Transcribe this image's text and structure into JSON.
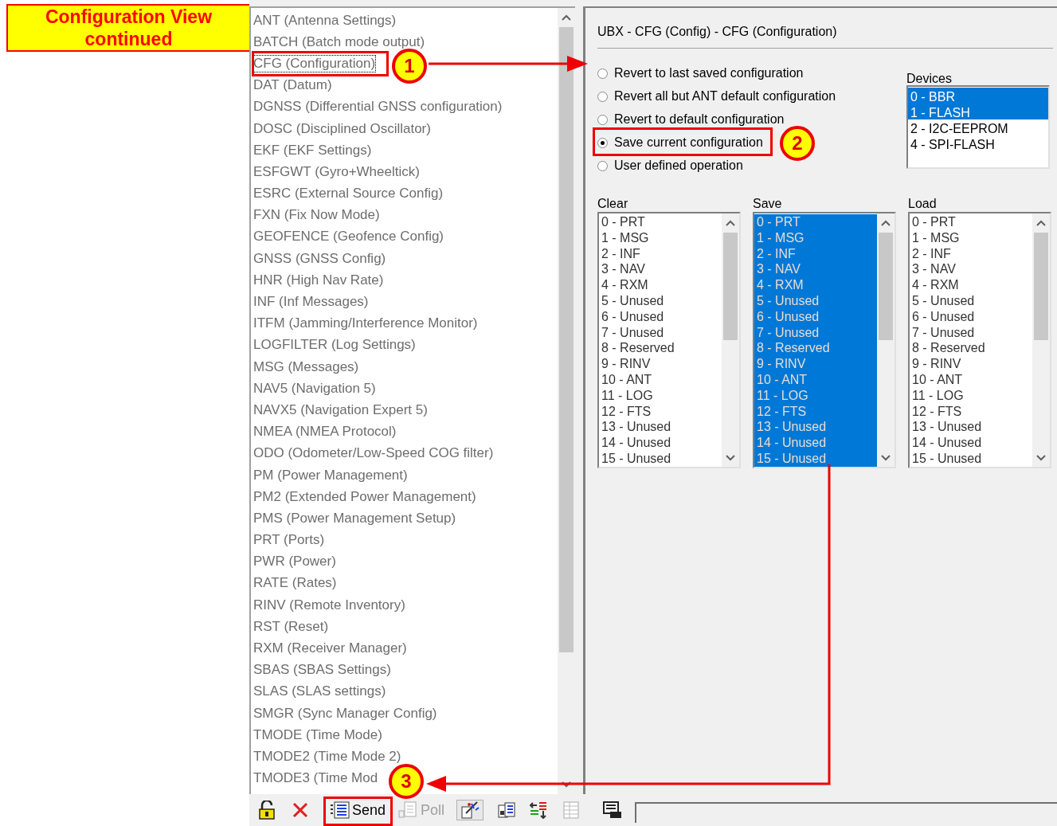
{
  "callout": {
    "text": "Configuration View continued"
  },
  "message_list": {
    "items": [
      {
        "label": "ANT (Antenna Settings)",
        "selected": false
      },
      {
        "label": "BATCH (Batch mode output)",
        "selected": false
      },
      {
        "label": "CFG (Configuration)",
        "selected": true
      },
      {
        "label": "DAT (Datum)",
        "selected": false
      },
      {
        "label": "DGNSS (Differential GNSS configuration)",
        "selected": false
      },
      {
        "label": "DOSC (Disciplined Oscillator)",
        "selected": false
      },
      {
        "label": "EKF (EKF Settings)",
        "selected": false
      },
      {
        "label": "ESFGWT (Gyro+Wheeltick)",
        "selected": false
      },
      {
        "label": "ESRC (External Source Config)",
        "selected": false
      },
      {
        "label": "FXN (Fix Now Mode)",
        "selected": false
      },
      {
        "label": "GEOFENCE (Geofence Config)",
        "selected": false
      },
      {
        "label": "GNSS (GNSS Config)",
        "selected": false
      },
      {
        "label": "HNR (High Nav Rate)",
        "selected": false
      },
      {
        "label": "INF (Inf Messages)",
        "selected": false
      },
      {
        "label": "ITFM (Jamming/Interference Monitor)",
        "selected": false
      },
      {
        "label": "LOGFILTER (Log Settings)",
        "selected": false
      },
      {
        "label": "MSG (Messages)",
        "selected": false
      },
      {
        "label": "NAV5 (Navigation 5)",
        "selected": false
      },
      {
        "label": "NAVX5 (Navigation Expert 5)",
        "selected": false
      },
      {
        "label": "NMEA (NMEA Protocol)",
        "selected": false
      },
      {
        "label": "ODO (Odometer/Low-Speed COG filter)",
        "selected": false
      },
      {
        "label": "PM (Power Management)",
        "selected": false
      },
      {
        "label": "PM2 (Extended Power Management)",
        "selected": false
      },
      {
        "label": "PMS (Power Management Setup)",
        "selected": false
      },
      {
        "label": "PRT (Ports)",
        "selected": false
      },
      {
        "label": "PWR (Power)",
        "selected": false
      },
      {
        "label": "RATE (Rates)",
        "selected": false
      },
      {
        "label": "RINV (Remote Inventory)",
        "selected": false
      },
      {
        "label": "RST (Reset)",
        "selected": false
      },
      {
        "label": "RXM (Receiver Manager)",
        "selected": false
      },
      {
        "label": "SBAS (SBAS Settings)",
        "selected": false
      },
      {
        "label": "SLAS (SLAS settings)",
        "selected": false
      },
      {
        "label": "SMGR (Sync Manager Config)",
        "selected": false
      },
      {
        "label": "TMODE (Time Mode)",
        "selected": false
      },
      {
        "label": "TMODE2 (Time Mode 2)",
        "selected": false
      },
      {
        "label": "TMODE3 (Time Mod",
        "selected": false
      }
    ]
  },
  "panel": {
    "title": "UBX - CFG (Config) - CFG (Configuration)",
    "options": [
      {
        "label": "Revert to last saved configuration",
        "selected": false
      },
      {
        "label": "Revert all but ANT default configuration",
        "selected": false
      },
      {
        "label": "Revert to default configuration",
        "selected": false
      },
      {
        "label": "Save current configuration",
        "selected": true
      },
      {
        "label": "User defined operation",
        "selected": false
      }
    ],
    "devices": {
      "label": "Devices",
      "items": [
        {
          "label": "0 - BBR",
          "selected": true
        },
        {
          "label": "1 - FLASH",
          "selected": true
        },
        {
          "label": "2 - I2C-EEPROM",
          "selected": false
        },
        {
          "label": "4 - SPI-FLASH",
          "selected": false
        }
      ]
    },
    "lists": [
      {
        "label": "Clear",
        "items": [
          {
            "label": "0 - PRT",
            "selected": false
          },
          {
            "label": "1 - MSG",
            "selected": false
          },
          {
            "label": "2 - INF",
            "selected": false
          },
          {
            "label": "3 - NAV",
            "selected": false
          },
          {
            "label": "4 - RXM",
            "selected": false
          },
          {
            "label": "5 - Unused",
            "selected": false
          },
          {
            "label": "6 - Unused",
            "selected": false
          },
          {
            "label": "7 - Unused",
            "selected": false
          },
          {
            "label": "8 - Reserved",
            "selected": false
          },
          {
            "label": "9 - RINV",
            "selected": false
          },
          {
            "label": "10 - ANT",
            "selected": false
          },
          {
            "label": "11 - LOG",
            "selected": false
          },
          {
            "label": "12 - FTS",
            "selected": false
          },
          {
            "label": "13 - Unused",
            "selected": false
          },
          {
            "label": "14 - Unused",
            "selected": false
          },
          {
            "label": "15 - Unused",
            "selected": false
          }
        ]
      },
      {
        "label": "Save",
        "items": [
          {
            "label": "0 - PRT",
            "selected": true
          },
          {
            "label": "1 - MSG",
            "selected": true
          },
          {
            "label": "2 - INF",
            "selected": true
          },
          {
            "label": "3 - NAV",
            "selected": true
          },
          {
            "label": "4 - RXM",
            "selected": true
          },
          {
            "label": "5 - Unused",
            "selected": true
          },
          {
            "label": "6 - Unused",
            "selected": true
          },
          {
            "label": "7 - Unused",
            "selected": true
          },
          {
            "label": "8 - Reserved",
            "selected": true
          },
          {
            "label": "9 - RINV",
            "selected": true
          },
          {
            "label": "10 - ANT",
            "selected": true
          },
          {
            "label": "11 - LOG",
            "selected": true
          },
          {
            "label": "12 - FTS",
            "selected": true
          },
          {
            "label": "13 - Unused",
            "selected": true
          },
          {
            "label": "14 - Unused",
            "selected": true
          },
          {
            "label": "15 - Unused",
            "selected": true
          }
        ]
      },
      {
        "label": "Load",
        "items": [
          {
            "label": "0 - PRT",
            "selected": false
          },
          {
            "label": "1 - MSG",
            "selected": false
          },
          {
            "label": "2 - INF",
            "selected": false
          },
          {
            "label": "3 - NAV",
            "selected": false
          },
          {
            "label": "4 - RXM",
            "selected": false
          },
          {
            "label": "5 - Unused",
            "selected": false
          },
          {
            "label": "6 - Unused",
            "selected": false
          },
          {
            "label": "7 - Unused",
            "selected": false
          },
          {
            "label": "8 - Reserved",
            "selected": false
          },
          {
            "label": "9 - RINV",
            "selected": false
          },
          {
            "label": "10 - ANT",
            "selected": false
          },
          {
            "label": "11 - LOG",
            "selected": false
          },
          {
            "label": "12 - FTS",
            "selected": false
          },
          {
            "label": "13 - Unused",
            "selected": false
          },
          {
            "label": "14 - Unused",
            "selected": false
          },
          {
            "label": "15 - Unused",
            "selected": false
          }
        ]
      }
    ]
  },
  "toolbar": {
    "buttons": [
      {
        "kind": "lock"
      },
      {
        "kind": "delete"
      },
      {
        "kind": "send",
        "label": "Send",
        "disabled": false
      },
      {
        "kind": "poll",
        "label": "Poll",
        "disabled": true
      },
      {
        "kind": "wizard"
      },
      {
        "kind": "document"
      },
      {
        "kind": "transfer"
      },
      {
        "kind": "table"
      },
      {
        "kind": "keyboard"
      }
    ]
  },
  "annotations": {
    "markers": [
      "1",
      "2",
      "3"
    ]
  }
}
